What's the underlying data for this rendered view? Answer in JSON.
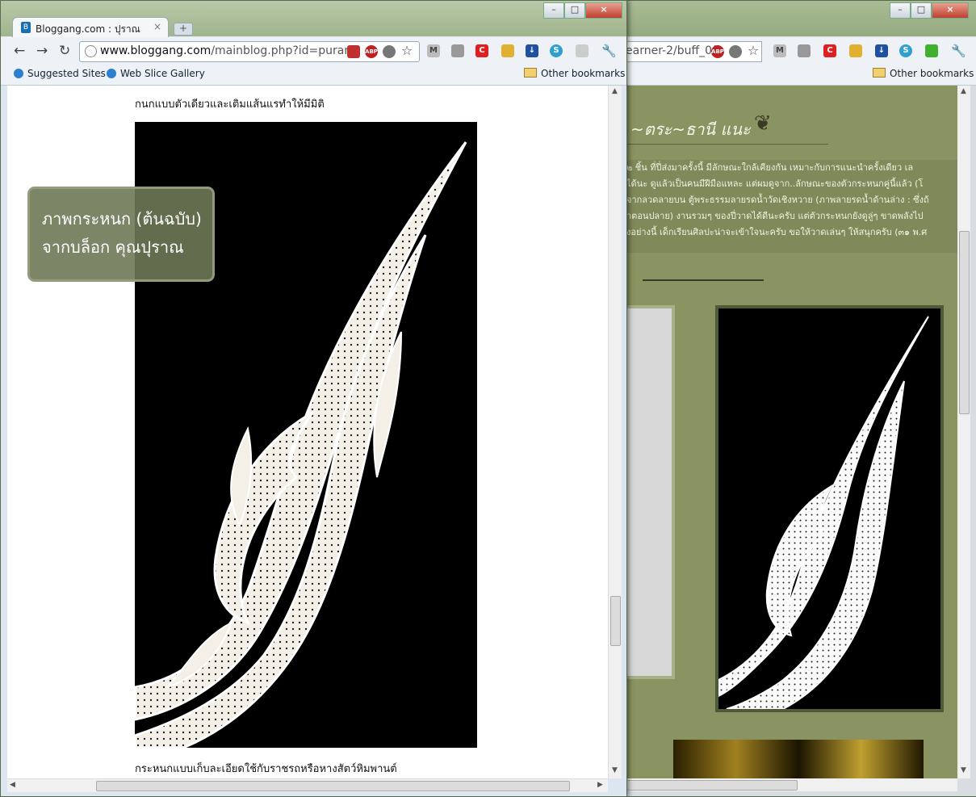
{
  "left_window": {
    "tab_title": "Bloggang.com : ปุราณ",
    "tab_close": "×",
    "new_tab": "+",
    "url_host": "www.bloggang.com",
    "url_path": "/mainblog.php?id=puran",
    "bookmarks": [
      "Suggested Sites",
      "Web Slice Gallery"
    ],
    "other_bookmarks": "Other bookmarks",
    "caption_top": "กนกแบบตัวเดียวและเติมแส้นแรทำให้มีมิติ",
    "caption_bottom": "กระหนกแบบเก็บละเอียดใช้กับราชรถหรือหางสัตว์หิมพานต์",
    "overlay_line1": "ภาพกระหนก (ต้นฉบับ)",
    "overlay_line2": "จากบล็อก คุณปุราณ"
  },
  "right_window": {
    "url_partial": "earner-2/buff_0(",
    "other_bookmarks": "Other bookmarks",
    "heading": "~ตระ~ธานี แนะ",
    "text_lines": [
      "๒ ชิ้น ที่ปี่ส่งมาครั้งนี้ มีลักษณะใกล้เคียงกัน เหมาะกับการแนะนำครั้งเดียว เล",
      "ได้นะ ดูแล้วเป็นคนมีฝีมือแหละ แต่ผมดูจาก..ลักษณะของตัวกระหนกคู่นี้แล้ว (โ",
      "จากลวดลายบน ตู้พระธรรมลายรดน้ำวัดเชิงหวาย (ภาพลายรดน้ำด้านล่าง : ซึ่งถ้",
      "าตอนปลาย) งานรวมๆ ของปี่วาดได้ดีนะครับ แต่ตัวกระหนกยังดูลู่ๆ ขาดพลังไป",
      "งอย่างนี้ เด็กเรียนศิลปะน่าจะเข้าใจนะครับ ขอให้วาดเล่นๆ ให้สนุกครับ (๓๑ พ.ศ"
    ]
  },
  "colors": {
    "accent_green": "#8a9462",
    "overlay_bg": "#6e7855"
  },
  "icons": [
    "back-icon",
    "forward-icon",
    "reload-icon",
    "star-icon",
    "gmail-icon",
    "wrench-icon"
  ]
}
